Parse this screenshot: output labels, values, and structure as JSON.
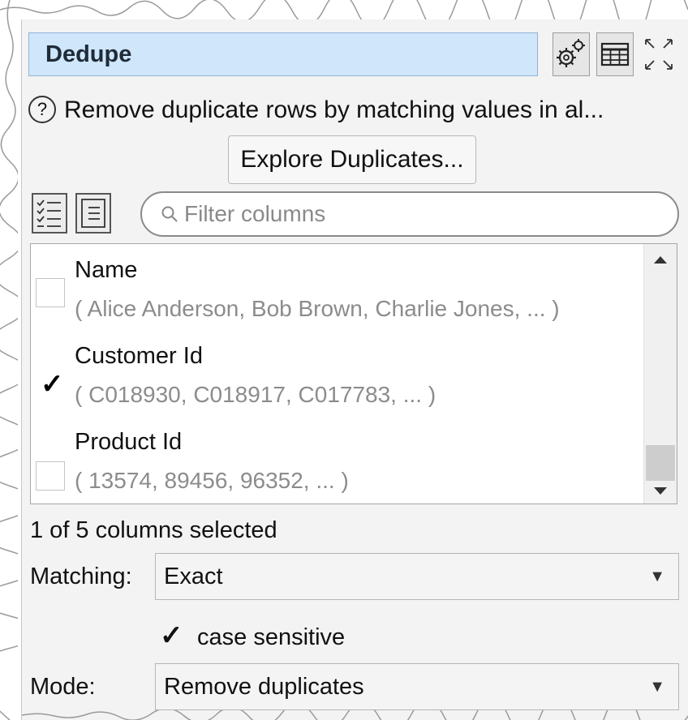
{
  "node": {
    "title": "Dedupe",
    "description": "Remove duplicate rows by matching values in al...",
    "explore_button": "Explore Duplicates...",
    "filter_placeholder": "Filter columns"
  },
  "columns": [
    {
      "name": "Name",
      "sample": "( Alice Anderson, Bob Brown, Charlie Jones, ... )",
      "checked": false
    },
    {
      "name": "Customer Id",
      "sample": "( C018930, C018917, C017783, ... )",
      "checked": true
    },
    {
      "name": "Product Id",
      "sample": "( 13574, 89456, 96352, ... )",
      "checked": false
    }
  ],
  "status": "1 of 5 columns selected",
  "matching": {
    "label": "Matching:",
    "value": "Exact"
  },
  "case_sensitive": {
    "label": "case sensitive",
    "checked": true
  },
  "mode": {
    "label": "Mode:",
    "value": "Remove duplicates"
  },
  "colors": {
    "title_bg": "#cfe6fb",
    "panel_bg": "#f3f3f3",
    "sample_text": "#8c8c8c"
  }
}
